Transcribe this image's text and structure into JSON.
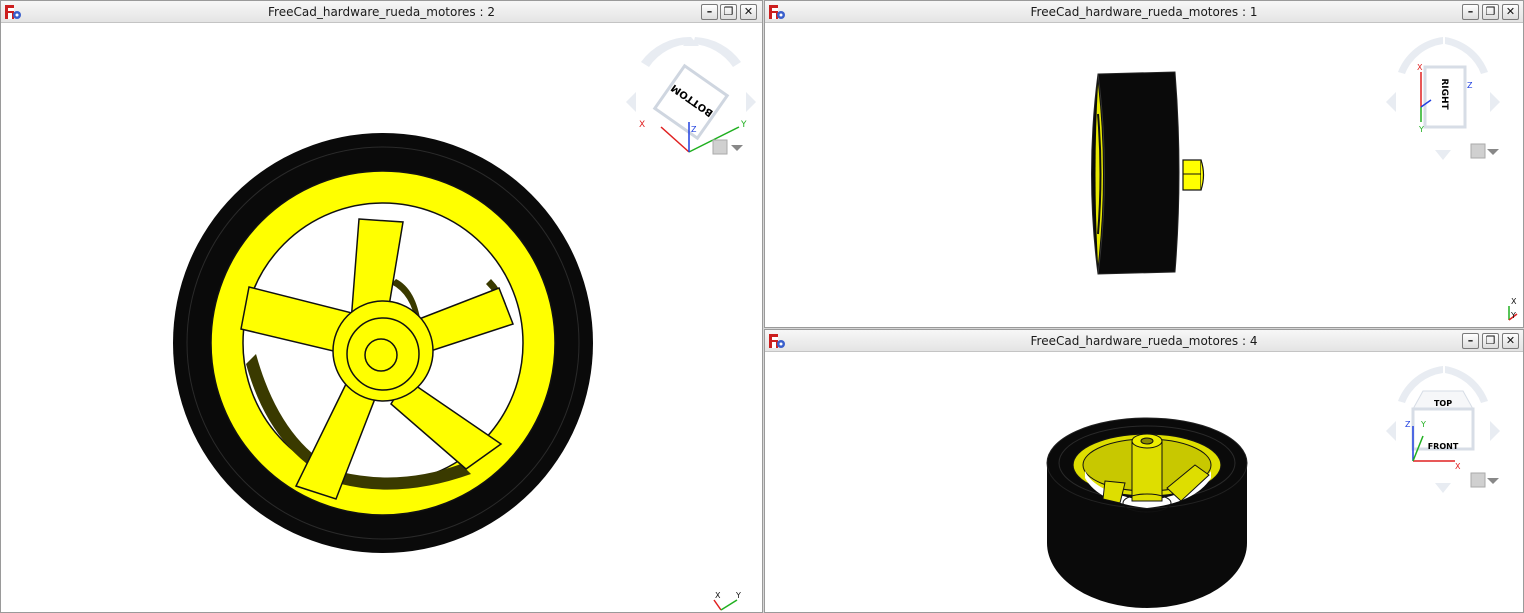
{
  "windows": [
    {
      "id": "view2",
      "title": "FreeCad_hardware_rueda_motores : 2",
      "cube_face": "BOTTOM"
    },
    {
      "id": "view1",
      "title": "FreeCad_hardware_rueda_motores : 1",
      "cube_face": "RIGHT"
    },
    {
      "id": "view4",
      "title": "FreeCad_hardware_rueda_motores : 4",
      "cube_faces": [
        "TOP",
        "FRONT"
      ]
    }
  ],
  "controls": {
    "minimize": "–",
    "restore": "❐",
    "close": "✕"
  },
  "axis_letters": {
    "x": "X",
    "y": "Y",
    "z": "Z"
  },
  "colors": {
    "rim": "#ffff00",
    "tire": "#0a0a0a",
    "shadow": "#3a3a00",
    "axis_x": "#e02020",
    "axis_y": "#20b020",
    "axis_z": "#2040e0"
  },
  "icons": [
    "freecad-logo-icon",
    "minimize-icon",
    "restore-icon",
    "close-icon",
    "view-menu-icon"
  ]
}
